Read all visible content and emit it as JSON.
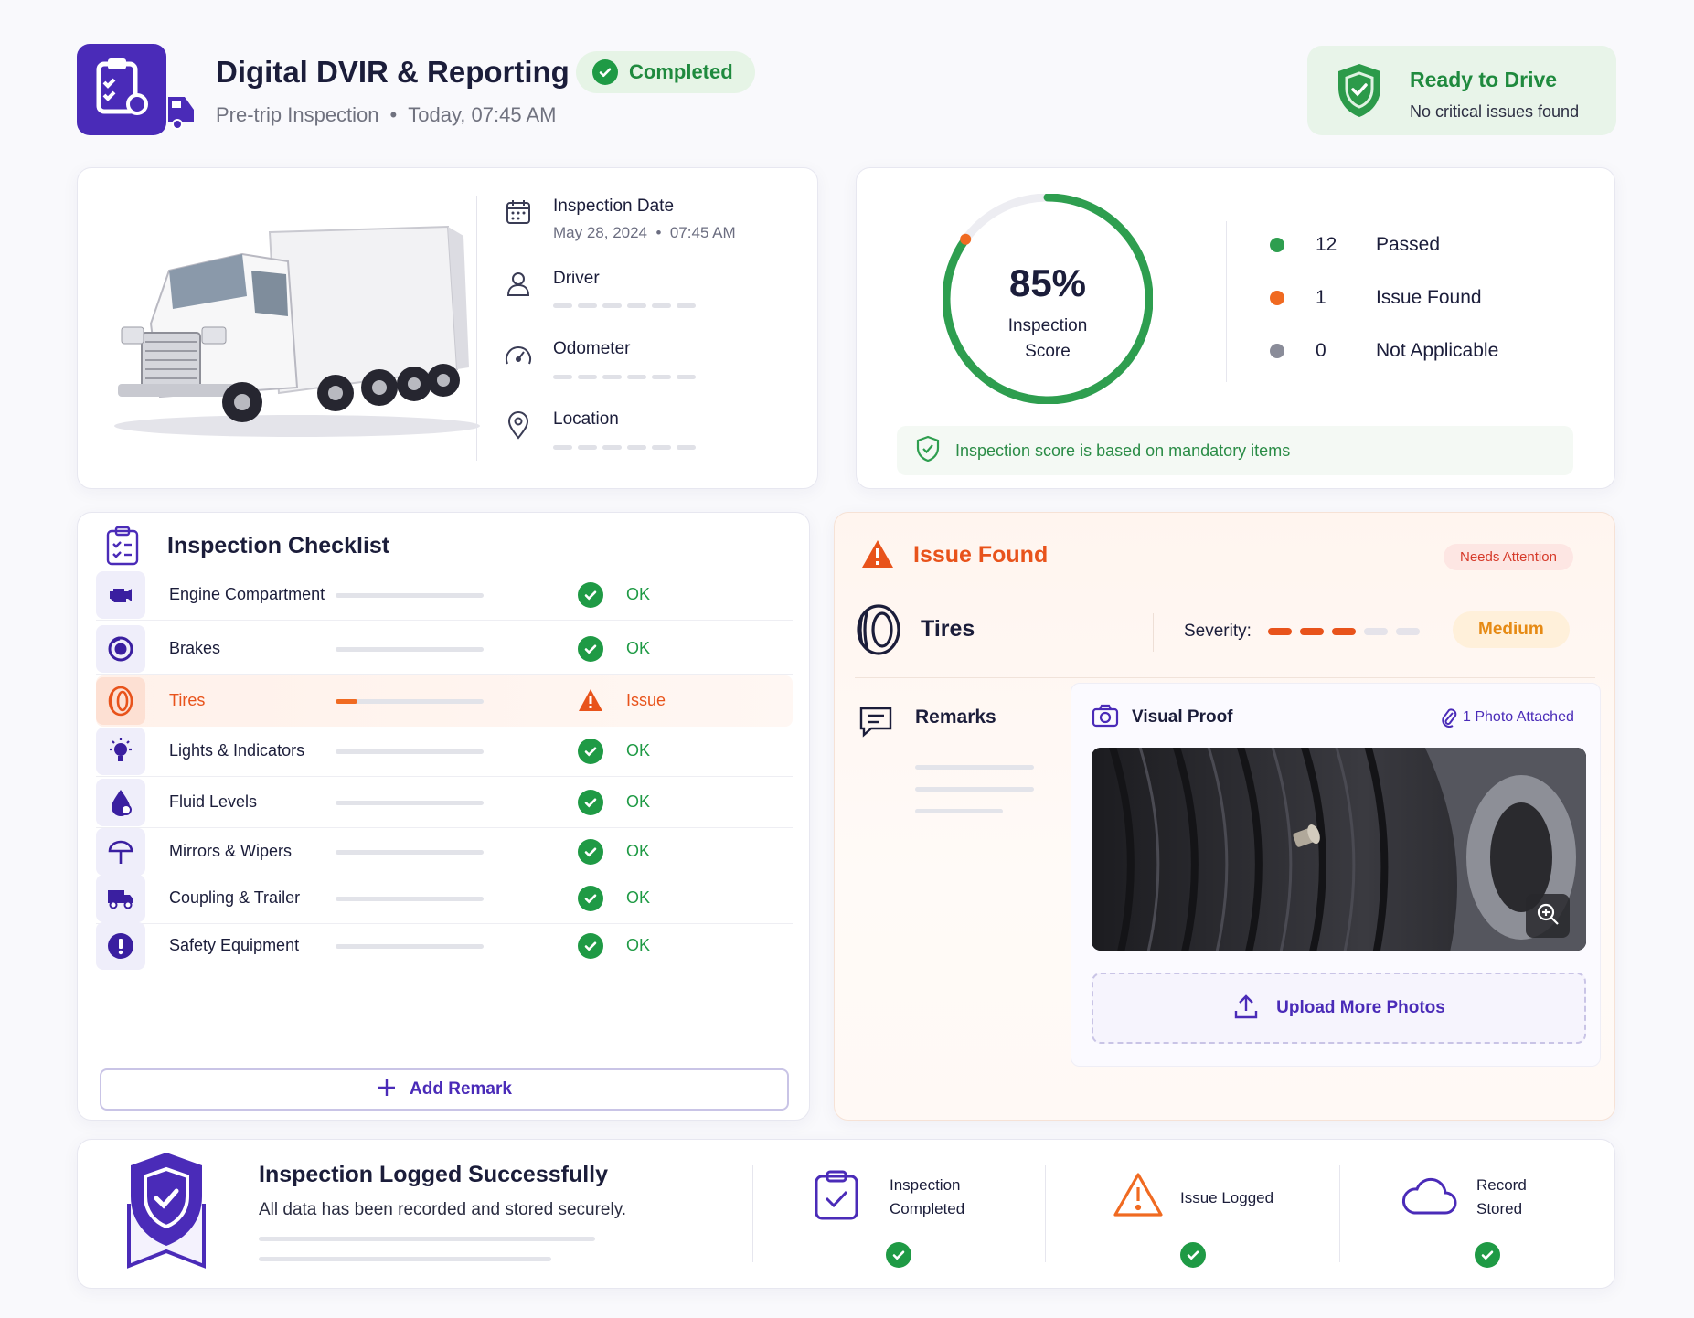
{
  "header": {
    "title": "Digital DVIR & Reporting",
    "status_badge": "Completed",
    "subtitle_type": "Pre-trip Inspection",
    "subtitle_sep": "•",
    "subtitle_time": "Today, 07:45 AM",
    "ready": {
      "title": "Ready to Drive",
      "subtitle": "No critical issues found"
    }
  },
  "vehicle": {
    "fields": [
      {
        "label": "Inspection Date",
        "value": "May 28, 2024  •  07:45 AM"
      },
      {
        "label": "Driver",
        "value": ""
      },
      {
        "label": "Odometer",
        "value": ""
      },
      {
        "label": "Location",
        "value": ""
      }
    ]
  },
  "score": {
    "value": "85%",
    "label_line1": "Inspection",
    "label_line2": "Score",
    "percent": 0.85,
    "legend": [
      {
        "count": "12",
        "label": "Passed",
        "color": "#2e9e4f"
      },
      {
        "count": "1",
        "label": "Issue Found",
        "color": "#f06a21"
      },
      {
        "count": "0",
        "label": "Not Applicable",
        "color": "#8a8c99"
      }
    ],
    "note": "Inspection score is based on mandatory items"
  },
  "checklist": {
    "title": "Inspection Checklist",
    "items": [
      {
        "label": "Engine Compartment",
        "status": "OK",
        "icon": "engine-icon"
      },
      {
        "label": "Brakes",
        "status": "OK",
        "icon": "brake-icon"
      },
      {
        "label": "Tires",
        "status": "Issue",
        "icon": "tire-icon",
        "progress": 0.15
      },
      {
        "label": "Lights & Indicators",
        "status": "OK",
        "icon": "bulb-icon"
      },
      {
        "label": "Fluid Levels",
        "status": "OK",
        "icon": "fluid-drop-icon"
      },
      {
        "label": "Mirrors & Wipers",
        "status": "OK",
        "icon": "wiper-icon"
      },
      {
        "label": "Coupling & Trailer",
        "status": "OK",
        "icon": "truck-icon"
      },
      {
        "label": "Safety Equipment",
        "status": "OK",
        "icon": "exclamation-icon"
      }
    ],
    "add_remark": "Add Remark"
  },
  "issue": {
    "title": "Issue Found",
    "badge": "Needs Attention",
    "item": "Tires",
    "severity_label": "Severity:",
    "severity_level": "Medium",
    "severity_value": 3,
    "severity_max": 5,
    "remarks_title": "Remarks",
    "visual_proof_title": "Visual Proof",
    "photo_count": "1 Photo Attached",
    "upload": "Upload More Photos"
  },
  "footer": {
    "title": "Inspection Logged Successfully",
    "subtitle": "All data has been recorded and stored securely.",
    "steps": [
      {
        "line1": "Inspection",
        "line2": "Completed",
        "icon": "clipboard-check-icon"
      },
      {
        "line1": "Issue Logged",
        "line2": "",
        "icon": "warning-icon"
      },
      {
        "line1": "Record",
        "line2": "Stored",
        "icon": "cloud-icon"
      }
    ]
  },
  "colors": {
    "brand": "#4a2bb8",
    "success": "#1f9a45",
    "issue": "#f06a21",
    "issue_text": "#e8531b"
  }
}
